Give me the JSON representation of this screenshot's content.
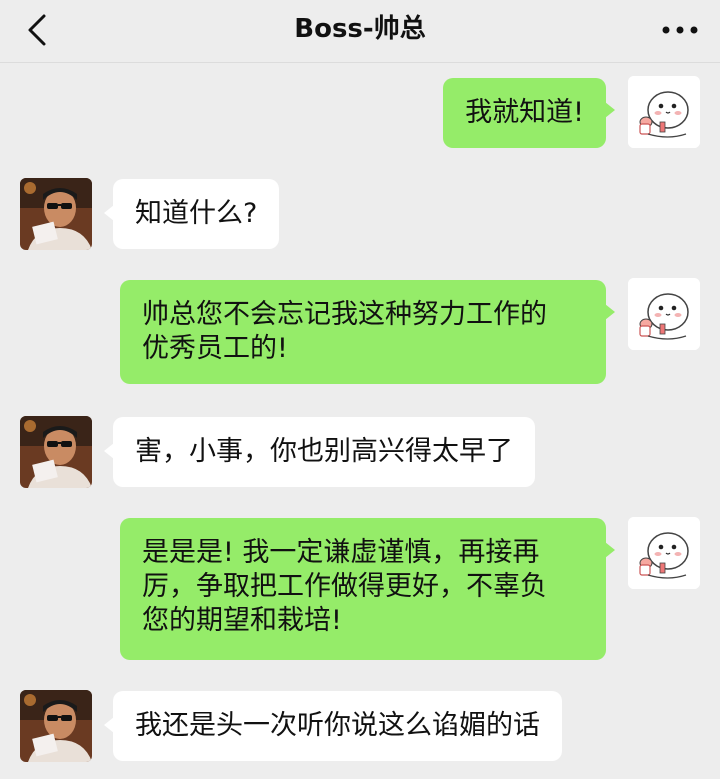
{
  "header": {
    "title": "Boss-帅总"
  },
  "icons": {
    "back": "chevron-left-icon",
    "more": "more-dots-icon"
  },
  "colors": {
    "background": "#ededed",
    "my_bubble": "#95ec69",
    "their_bubble": "#ffffff"
  },
  "messages": [
    {
      "from": "me",
      "lines": [
        "我就知道!"
      ]
    },
    {
      "from": "boss",
      "lines": [
        "知道什么?"
      ]
    },
    {
      "from": "me",
      "lines": [
        "帅总您不会忘记我这种努力工作的",
        "优秀员工的!"
      ]
    },
    {
      "from": "boss",
      "lines": [
        "害，小事，你也别高兴得太早了"
      ]
    },
    {
      "from": "me",
      "lines": [
        "是是是! 我一定谦虚谨慎，再接再",
        "厉，争取把工作做得更好，不辜负",
        "您的期望和栽培!"
      ]
    },
    {
      "from": "boss",
      "lines": [
        "我还是头一次听你说这么谄媚的话"
      ]
    }
  ]
}
